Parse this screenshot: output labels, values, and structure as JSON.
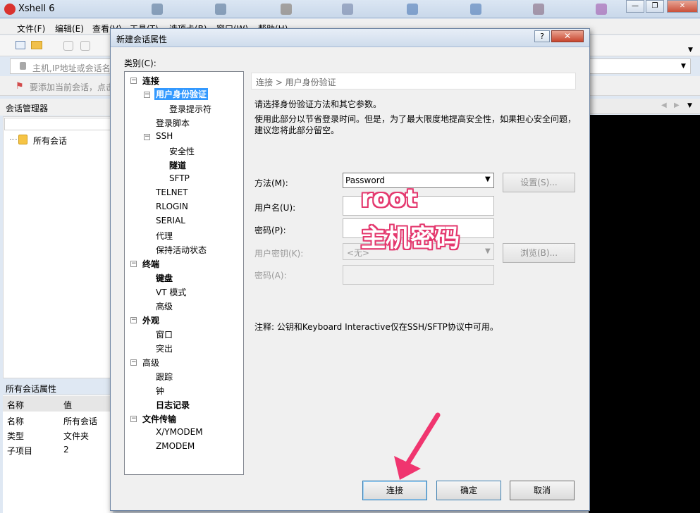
{
  "window": {
    "title": "Xshell 6"
  },
  "menubar": [
    "文件(F)",
    "编辑(E)",
    "查看(V)",
    "工具(T)",
    "选项卡(B)",
    "窗口(W)",
    "帮助(H)"
  ],
  "address": {
    "placeholder": "主机,IP地址或会话名"
  },
  "hint": {
    "text": "要添加当前会话，点击"
  },
  "session_manager": {
    "title": "会话管理器",
    "root": "所有会话"
  },
  "properties": {
    "title": "所有会话属性",
    "headers": [
      "名称",
      "值"
    ],
    "rows": [
      [
        "名称",
        "所有会话"
      ],
      [
        "类型",
        "文件夹"
      ],
      [
        "子项目",
        "2"
      ]
    ]
  },
  "dialog": {
    "title": "新建会话属性",
    "help": "?",
    "close": "✕",
    "category_label": "类别(C):",
    "tree": {
      "connection": "连接",
      "auth": "用户身份验证",
      "login_prompt": "登录提示符",
      "login_script": "登录脚本",
      "ssh": "SSH",
      "security": "安全性",
      "tunnel": "隧道",
      "sftp": "SFTP",
      "telnet": "TELNET",
      "rlogin": "RLOGIN",
      "serial": "SERIAL",
      "proxy": "代理",
      "keepalive": "保持活动状态",
      "terminal": "终端",
      "keyboard": "键盘",
      "vt_mode": "VT 模式",
      "advanced_term": "高级",
      "appearance": "外观",
      "window": "窗口",
      "highlight": "突出",
      "advanced": "高级",
      "trace": "跟踪",
      "bell": "钟",
      "logging": "日志记录",
      "file_transfer": "文件传输",
      "xymodem": "X/YMODEM",
      "zmodem": "ZMODEM"
    },
    "breadcrumb": "连接 > 用户身份验证",
    "desc1": "请选择身份验证方法和其它参数。",
    "desc2": "使用此部分以节省登录时间。但是，为了最大限度地提高安全性，如果担心安全问题，建议您将此部分留空。",
    "method_label": "方法(M):",
    "method_value": "Password",
    "settings_button": "设置(S)...",
    "username_label": "用户名(U):",
    "password_label": "密码(P):",
    "userkey_label": "用户密钥(K):",
    "userkey_value": "<无>",
    "browse_button": "浏览(B)...",
    "passphrase_label": "密码(A):",
    "note": "注释: 公钥和Keyboard Interactive仅在SSH/SFTP协议中可用。",
    "buttons": {
      "connect": "连接",
      "ok": "确定",
      "cancel": "取消"
    }
  },
  "annotations": {
    "username": "root",
    "password": "主机密码",
    "arrow_color": "#f0356f"
  }
}
